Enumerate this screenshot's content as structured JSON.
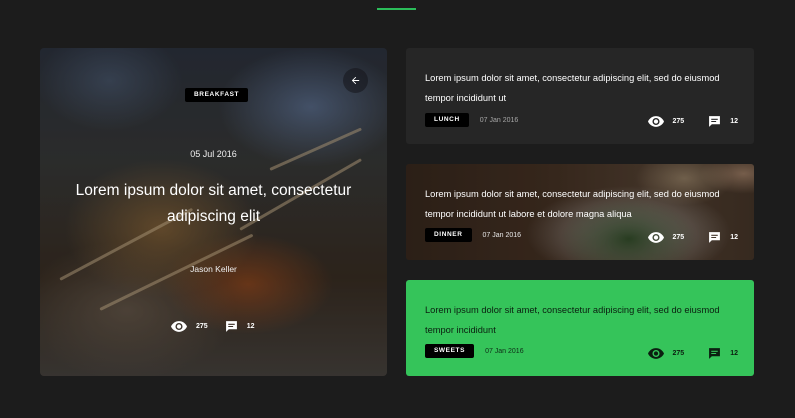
{
  "accent_color": "#2bbd5a",
  "feature": {
    "tag": "BREAKFAST",
    "date": "05 Jul 2016",
    "title": "Lorem ipsum dolor sit amet, consectetur adipiscing elit",
    "author": "Jason Keller",
    "views": "275",
    "comments": "12",
    "back_icon": "arrow-left-icon"
  },
  "cards": [
    {
      "text": "Lorem ipsum dolor sit amet, consectetur adipiscing elit, sed do eiusmod tempor incididunt ut",
      "tag": "LUNCH",
      "date": "07 Jan 2016",
      "views": "275",
      "comments": "12"
    },
    {
      "text": "Lorem ipsum dolor sit amet, consectetur adipiscing elit, sed do eiusmod tempor incididunt ut labore et dolore magna aliqua",
      "tag": "DINNER",
      "date": "07 Jan 2016",
      "views": "275",
      "comments": "12"
    },
    {
      "text": "Lorem ipsum dolor sit amet, consectetur adipiscing elit, sed do eiusmod tempor incididunt",
      "tag": "SWEETS",
      "date": "07 Jan 2016",
      "views": "275",
      "comments": "12",
      "background": "#35c45a"
    }
  ],
  "icons": {
    "views": "eye-icon",
    "comments": "comment-icon"
  }
}
